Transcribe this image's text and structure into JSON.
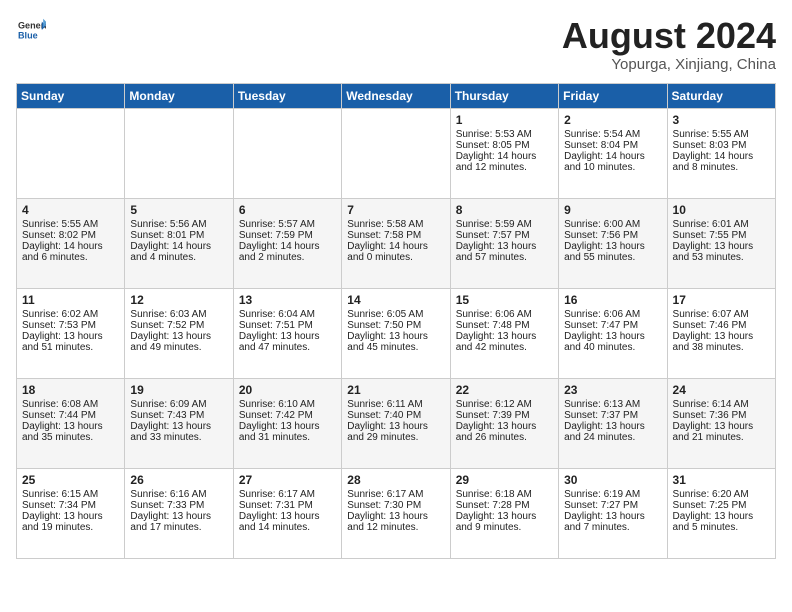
{
  "header": {
    "logo_general": "General",
    "logo_blue": "Blue",
    "month_year": "August 2024",
    "location": "Yopurga, Xinjiang, China"
  },
  "days_of_week": [
    "Sunday",
    "Monday",
    "Tuesday",
    "Wednesday",
    "Thursday",
    "Friday",
    "Saturday"
  ],
  "weeks": [
    [
      {
        "day": "",
        "sunrise": "",
        "sunset": "",
        "daylight": ""
      },
      {
        "day": "",
        "sunrise": "",
        "sunset": "",
        "daylight": ""
      },
      {
        "day": "",
        "sunrise": "",
        "sunset": "",
        "daylight": ""
      },
      {
        "day": "",
        "sunrise": "",
        "sunset": "",
        "daylight": ""
      },
      {
        "day": "1",
        "sunrise": "Sunrise: 5:53 AM",
        "sunset": "Sunset: 8:05 PM",
        "daylight": "Daylight: 14 hours and 12 minutes."
      },
      {
        "day": "2",
        "sunrise": "Sunrise: 5:54 AM",
        "sunset": "Sunset: 8:04 PM",
        "daylight": "Daylight: 14 hours and 10 minutes."
      },
      {
        "day": "3",
        "sunrise": "Sunrise: 5:55 AM",
        "sunset": "Sunset: 8:03 PM",
        "daylight": "Daylight: 14 hours and 8 minutes."
      }
    ],
    [
      {
        "day": "4",
        "sunrise": "Sunrise: 5:55 AM",
        "sunset": "Sunset: 8:02 PM",
        "daylight": "Daylight: 14 hours and 6 minutes."
      },
      {
        "day": "5",
        "sunrise": "Sunrise: 5:56 AM",
        "sunset": "Sunset: 8:01 PM",
        "daylight": "Daylight: 14 hours and 4 minutes."
      },
      {
        "day": "6",
        "sunrise": "Sunrise: 5:57 AM",
        "sunset": "Sunset: 7:59 PM",
        "daylight": "Daylight: 14 hours and 2 minutes."
      },
      {
        "day": "7",
        "sunrise": "Sunrise: 5:58 AM",
        "sunset": "Sunset: 7:58 PM",
        "daylight": "Daylight: 14 hours and 0 minutes."
      },
      {
        "day": "8",
        "sunrise": "Sunrise: 5:59 AM",
        "sunset": "Sunset: 7:57 PM",
        "daylight": "Daylight: 13 hours and 57 minutes."
      },
      {
        "day": "9",
        "sunrise": "Sunrise: 6:00 AM",
        "sunset": "Sunset: 7:56 PM",
        "daylight": "Daylight: 13 hours and 55 minutes."
      },
      {
        "day": "10",
        "sunrise": "Sunrise: 6:01 AM",
        "sunset": "Sunset: 7:55 PM",
        "daylight": "Daylight: 13 hours and 53 minutes."
      }
    ],
    [
      {
        "day": "11",
        "sunrise": "Sunrise: 6:02 AM",
        "sunset": "Sunset: 7:53 PM",
        "daylight": "Daylight: 13 hours and 51 minutes."
      },
      {
        "day": "12",
        "sunrise": "Sunrise: 6:03 AM",
        "sunset": "Sunset: 7:52 PM",
        "daylight": "Daylight: 13 hours and 49 minutes."
      },
      {
        "day": "13",
        "sunrise": "Sunrise: 6:04 AM",
        "sunset": "Sunset: 7:51 PM",
        "daylight": "Daylight: 13 hours and 47 minutes."
      },
      {
        "day": "14",
        "sunrise": "Sunrise: 6:05 AM",
        "sunset": "Sunset: 7:50 PM",
        "daylight": "Daylight: 13 hours and 45 minutes."
      },
      {
        "day": "15",
        "sunrise": "Sunrise: 6:06 AM",
        "sunset": "Sunset: 7:48 PM",
        "daylight": "Daylight: 13 hours and 42 minutes."
      },
      {
        "day": "16",
        "sunrise": "Sunrise: 6:06 AM",
        "sunset": "Sunset: 7:47 PM",
        "daylight": "Daylight: 13 hours and 40 minutes."
      },
      {
        "day": "17",
        "sunrise": "Sunrise: 6:07 AM",
        "sunset": "Sunset: 7:46 PM",
        "daylight": "Daylight: 13 hours and 38 minutes."
      }
    ],
    [
      {
        "day": "18",
        "sunrise": "Sunrise: 6:08 AM",
        "sunset": "Sunset: 7:44 PM",
        "daylight": "Daylight: 13 hours and 35 minutes."
      },
      {
        "day": "19",
        "sunrise": "Sunrise: 6:09 AM",
        "sunset": "Sunset: 7:43 PM",
        "daylight": "Daylight: 13 hours and 33 minutes."
      },
      {
        "day": "20",
        "sunrise": "Sunrise: 6:10 AM",
        "sunset": "Sunset: 7:42 PM",
        "daylight": "Daylight: 13 hours and 31 minutes."
      },
      {
        "day": "21",
        "sunrise": "Sunrise: 6:11 AM",
        "sunset": "Sunset: 7:40 PM",
        "daylight": "Daylight: 13 hours and 29 minutes."
      },
      {
        "day": "22",
        "sunrise": "Sunrise: 6:12 AM",
        "sunset": "Sunset: 7:39 PM",
        "daylight": "Daylight: 13 hours and 26 minutes."
      },
      {
        "day": "23",
        "sunrise": "Sunrise: 6:13 AM",
        "sunset": "Sunset: 7:37 PM",
        "daylight": "Daylight: 13 hours and 24 minutes."
      },
      {
        "day": "24",
        "sunrise": "Sunrise: 6:14 AM",
        "sunset": "Sunset: 7:36 PM",
        "daylight": "Daylight: 13 hours and 21 minutes."
      }
    ],
    [
      {
        "day": "25",
        "sunrise": "Sunrise: 6:15 AM",
        "sunset": "Sunset: 7:34 PM",
        "daylight": "Daylight: 13 hours and 19 minutes."
      },
      {
        "day": "26",
        "sunrise": "Sunrise: 6:16 AM",
        "sunset": "Sunset: 7:33 PM",
        "daylight": "Daylight: 13 hours and 17 minutes."
      },
      {
        "day": "27",
        "sunrise": "Sunrise: 6:17 AM",
        "sunset": "Sunset: 7:31 PM",
        "daylight": "Daylight: 13 hours and 14 minutes."
      },
      {
        "day": "28",
        "sunrise": "Sunrise: 6:17 AM",
        "sunset": "Sunset: 7:30 PM",
        "daylight": "Daylight: 13 hours and 12 minutes."
      },
      {
        "day": "29",
        "sunrise": "Sunrise: 6:18 AM",
        "sunset": "Sunset: 7:28 PM",
        "daylight": "Daylight: 13 hours and 9 minutes."
      },
      {
        "day": "30",
        "sunrise": "Sunrise: 6:19 AM",
        "sunset": "Sunset: 7:27 PM",
        "daylight": "Daylight: 13 hours and 7 minutes."
      },
      {
        "day": "31",
        "sunrise": "Sunrise: 6:20 AM",
        "sunset": "Sunset: 7:25 PM",
        "daylight": "Daylight: 13 hours and 5 minutes."
      }
    ]
  ]
}
